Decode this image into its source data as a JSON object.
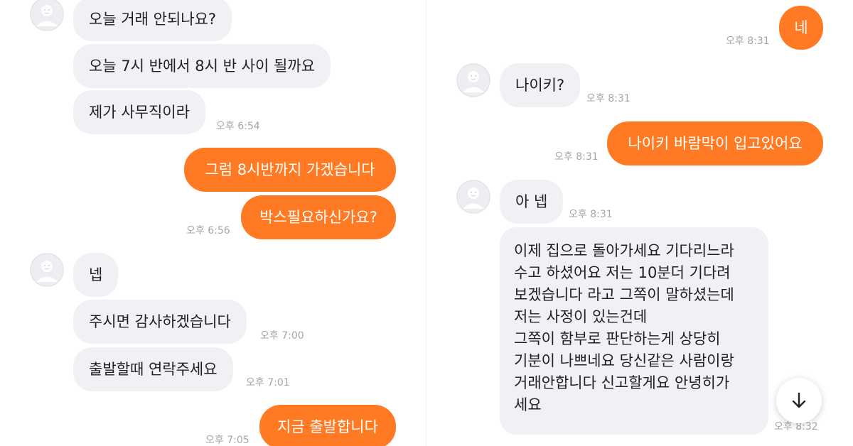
{
  "left": {
    "messages": [
      {
        "text": "오늘 거래 안되나요?"
      },
      {
        "text": "오늘 7시 반에서 8시 반 사이 될까요"
      },
      {
        "text": "제가 사무직이라",
        "time": "오후 6:54"
      },
      {
        "text": "그럼 8시반까지 가겠습니다"
      },
      {
        "text": "박스필요하신가요?",
        "time": "오후 6:56"
      },
      {
        "text": "넵"
      },
      {
        "text": "주시면 감사하겠습니다",
        "time": "오후 7:00"
      },
      {
        "text": "출발할때 연락주세요",
        "time": "오후 7:01"
      },
      {
        "text": "지금 출발합니다",
        "time": "오후 7:05"
      }
    ]
  },
  "right": {
    "messages": [
      {
        "text": "네",
        "time": "오후 8:31"
      },
      {
        "text": "나이키?",
        "time": "오후 8:31"
      },
      {
        "text": "나이키 바람막이 입고있어요",
        "time": "오후 8:31"
      },
      {
        "text": "아 넵",
        "time": "오후 8:31"
      },
      {
        "lines": [
          "이제 집으로 돌아가세요 기다리느라",
          "수고 하셨어요 저는 10분더 기다려",
          "보겠습니다 라고 그쪽이 말하셨는데",
          "저는 사정이 있는건데",
          "그쪽이 함부로 판단하는게 상당히",
          "기분이 나쁘네요 당신같은 사람이랑",
          "거래안합니다 신고할게요 안녕히가",
          "세요"
        ],
        "time": "오후 8:32"
      }
    ]
  },
  "colors": {
    "outgoing_bubble": "#ff7a22",
    "incoming_bubble": "#f0f1f5",
    "timestamp": "#a3a6ab"
  },
  "icons": {
    "avatar": "default-profile-icon",
    "scroll_down": "arrow-down-icon"
  }
}
